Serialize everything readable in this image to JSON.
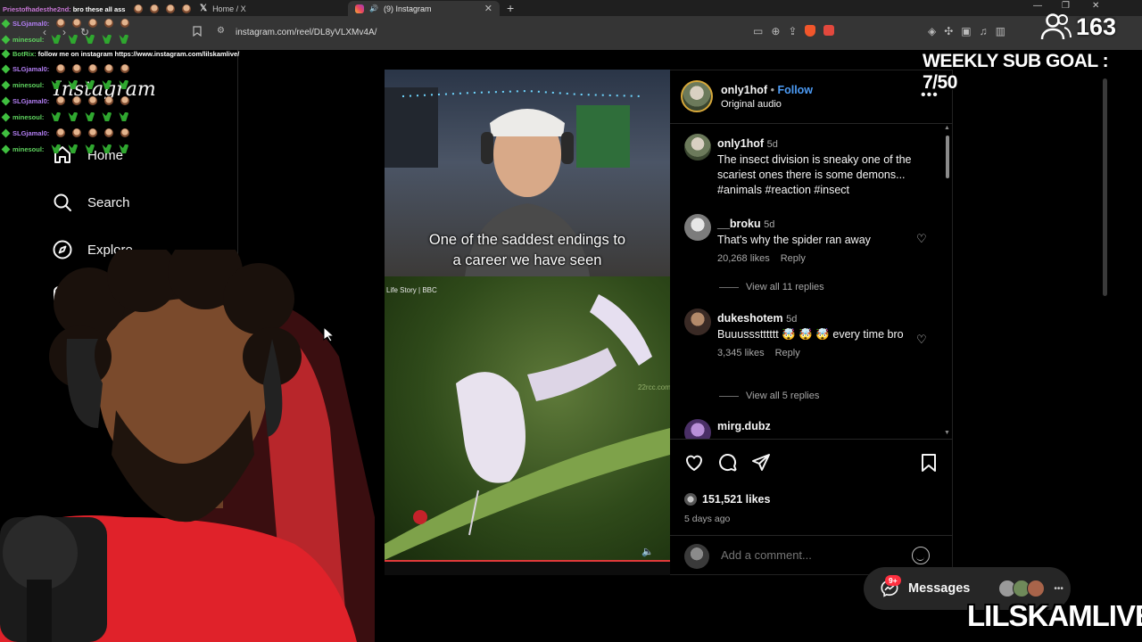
{
  "browser": {
    "tabs": [
      {
        "label": "",
        "icon": "twitch-chat"
      },
      {
        "label": "Home / X",
        "icon": "x-logo"
      },
      {
        "label": "(9) Instagram",
        "icon": "instagram-logo",
        "active": true
      }
    ],
    "url": "instagram.com/reel/DL8yVLXMv4A/"
  },
  "chat": [
    {
      "user": "Priestofhadesthe2nd:",
      "message": "bro these all ass",
      "color": "pink"
    },
    {
      "user": "SLGjamal0:",
      "message": "",
      "emote": "face",
      "color": "purple"
    },
    {
      "user": "minesoul:",
      "message": "",
      "emote": "green",
      "color": "green"
    },
    {
      "user": "BotRix:",
      "message": "follow me on instagram https://www.instagram.com/lilskamlive/",
      "color": "green"
    },
    {
      "user": "SLGjamal0:",
      "message": "",
      "emote": "face",
      "color": "purple"
    },
    {
      "user": "minesoul:",
      "message": "",
      "emote": "green",
      "color": "green"
    },
    {
      "user": "SLGjamal0:",
      "message": "",
      "emote": "face",
      "color": "purple"
    },
    {
      "user": "minesoul:",
      "message": "",
      "emote": "green",
      "color": "green"
    },
    {
      "user": "SLGjamal0:",
      "message": "",
      "emote": "face",
      "color": "purple"
    },
    {
      "user": "minesoul:",
      "message": "",
      "emote": "green",
      "color": "green"
    }
  ],
  "sidebar": {
    "logo": "Instagram",
    "items": [
      {
        "label": "Home",
        "icon": "home-icon"
      },
      {
        "label": "Search",
        "icon": "search-icon"
      },
      {
        "label": "Explore",
        "icon": "explore-icon"
      },
      {
        "label": "",
        "icon": "reels-icon"
      }
    ]
  },
  "video": {
    "caption_line1": "One of the saddest endings to",
    "caption_line2": "a career we have seen",
    "source_tag": "Life Story | BBC",
    "watermark": "22rcc.com",
    "progress": 1.0
  },
  "post": {
    "author": "only1hof",
    "follow_sep": "•",
    "follow_label": "Follow",
    "audio": "Original audio",
    "caption": {
      "user": "only1hof",
      "age": "5d",
      "text": "The insect division is sneaky one of the scariest ones there is some demons...",
      "hashtags": "#animals #reaction #insect"
    },
    "comments": [
      {
        "user": "__broku",
        "age": "5d",
        "text": "That's why the spider ran away",
        "likes": "20,268 likes",
        "reply": "Reply",
        "view_replies": "View all 11 replies"
      },
      {
        "user": "dukeshotem",
        "age": "5d",
        "text": "Buuussstttttt 🤯 🤯 🤯 every time bro",
        "likes": "3,345 likes",
        "reply": "Reply",
        "view_replies": "View all 5 replies"
      },
      {
        "user": "mirg.dubz",
        "age": "",
        "text": "",
        "likes": "",
        "reply": "",
        "view_replies": ""
      }
    ],
    "like_count": "151,521 likes",
    "date": "5 days ago",
    "add_comment_placeholder": "Add a comment..."
  },
  "messages": {
    "label": "Messages",
    "badge": "9+"
  },
  "overlay": {
    "viewer_count": "163",
    "sub_goal": "WEEKLY SUB GOAL : 7/50",
    "streamer": "LILSKAMLIVE"
  },
  "colors": {
    "accent_blue": "#4c9bf5",
    "badge_red": "#ff3040",
    "progress_red": "#e03a3a"
  }
}
